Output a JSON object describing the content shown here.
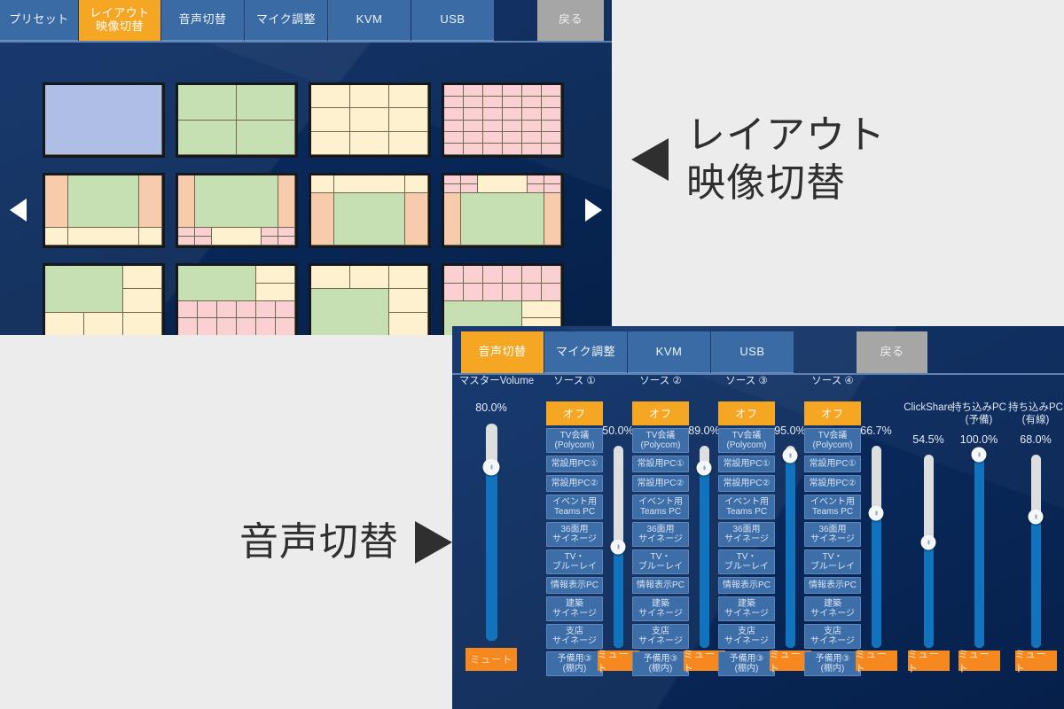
{
  "layout_panel": {
    "tabs": [
      {
        "name": "preset",
        "l1": "プリセット",
        "l2": "",
        "state": "normal"
      },
      {
        "name": "layout-video-switch",
        "l1": "レイアウト",
        "l2": "映像切替",
        "state": "active"
      },
      {
        "name": "audio-switch",
        "l1": "音声切替",
        "l2": "",
        "state": "normal"
      },
      {
        "name": "mic-adjust",
        "l1": "マイク調整",
        "l2": "",
        "state": "normal"
      },
      {
        "name": "kvm",
        "l1": "KVM",
        "l2": "",
        "state": "normal"
      },
      {
        "name": "usb",
        "l1": "USB",
        "l2": "",
        "state": "normal"
      },
      {
        "name": "back",
        "l1": "戻る",
        "l2": "",
        "state": "back"
      }
    ],
    "prev_arrow": "◀",
    "next_arrow": "▶",
    "tiles": [
      {
        "id": "tile-1",
        "selected": true,
        "cols": "1fr",
        "rows": "1fr",
        "cells": [
          {
            "c": "c-blue",
            "cs": 1,
            "rs": 1
          }
        ]
      },
      {
        "id": "tile-2",
        "selected": false,
        "cols": "1fr 1fr",
        "rows": "1fr 1fr",
        "cells": [
          {
            "c": "c-green",
            "cs": 1,
            "rs": 1
          },
          {
            "c": "c-green",
            "cs": 1,
            "rs": 1
          },
          {
            "c": "c-green",
            "cs": 1,
            "rs": 1
          },
          {
            "c": "c-green",
            "cs": 1,
            "rs": 1
          }
        ]
      },
      {
        "id": "tile-3",
        "selected": false,
        "cols": "1fr 1fr 1fr",
        "rows": "1fr 1fr 1fr",
        "cells": [
          {
            "c": "c-cream",
            "cs": 1,
            "rs": 1
          },
          {
            "c": "c-cream",
            "cs": 1,
            "rs": 1
          },
          {
            "c": "c-cream",
            "cs": 1,
            "rs": 1
          },
          {
            "c": "c-cream",
            "cs": 1,
            "rs": 1
          },
          {
            "c": "c-cream",
            "cs": 1,
            "rs": 1
          },
          {
            "c": "c-cream",
            "cs": 1,
            "rs": 1
          },
          {
            "c": "c-cream",
            "cs": 1,
            "rs": 1
          },
          {
            "c": "c-cream",
            "cs": 1,
            "rs": 1
          },
          {
            "c": "c-cream",
            "cs": 1,
            "rs": 1
          }
        ]
      },
      {
        "id": "tile-4",
        "selected": false,
        "cols": "repeat(6,1fr)",
        "rows": "repeat(6,1fr)",
        "cells": [
          {
            "c": "c-pink",
            "cs": 1,
            "rs": 1
          },
          {
            "c": "c-pink",
            "cs": 1,
            "rs": 1
          },
          {
            "c": "c-pink",
            "cs": 1,
            "rs": 1
          },
          {
            "c": "c-pink",
            "cs": 1,
            "rs": 1
          },
          {
            "c": "c-pink",
            "cs": 1,
            "rs": 1
          },
          {
            "c": "c-pink",
            "cs": 1,
            "rs": 1
          },
          {
            "c": "c-pink",
            "cs": 1,
            "rs": 1
          },
          {
            "c": "c-pink",
            "cs": 1,
            "rs": 1
          },
          {
            "c": "c-pink",
            "cs": 1,
            "rs": 1
          },
          {
            "c": "c-pink",
            "cs": 1,
            "rs": 1
          },
          {
            "c": "c-pink",
            "cs": 1,
            "rs": 1
          },
          {
            "c": "c-pink",
            "cs": 1,
            "rs": 1
          },
          {
            "c": "c-pink",
            "cs": 1,
            "rs": 1
          },
          {
            "c": "c-pink",
            "cs": 1,
            "rs": 1
          },
          {
            "c": "c-pink",
            "cs": 1,
            "rs": 1
          },
          {
            "c": "c-pink",
            "cs": 1,
            "rs": 1
          },
          {
            "c": "c-pink",
            "cs": 1,
            "rs": 1
          },
          {
            "c": "c-pink",
            "cs": 1,
            "rs": 1
          },
          {
            "c": "c-pink",
            "cs": 1,
            "rs": 1
          },
          {
            "c": "c-pink",
            "cs": 1,
            "rs": 1
          },
          {
            "c": "c-pink",
            "cs": 1,
            "rs": 1
          },
          {
            "c": "c-pink",
            "cs": 1,
            "rs": 1
          },
          {
            "c": "c-pink",
            "cs": 1,
            "rs": 1
          },
          {
            "c": "c-pink",
            "cs": 1,
            "rs": 1
          },
          {
            "c": "c-pink",
            "cs": 1,
            "rs": 1
          },
          {
            "c": "c-pink",
            "cs": 1,
            "rs": 1
          },
          {
            "c": "c-pink",
            "cs": 1,
            "rs": 1
          },
          {
            "c": "c-pink",
            "cs": 1,
            "rs": 1
          },
          {
            "c": "c-pink",
            "cs": 1,
            "rs": 1
          },
          {
            "c": "c-pink",
            "cs": 1,
            "rs": 1
          },
          {
            "c": "c-pink",
            "cs": 1,
            "rs": 1
          },
          {
            "c": "c-pink",
            "cs": 1,
            "rs": 1
          },
          {
            "c": "c-pink",
            "cs": 1,
            "rs": 1
          },
          {
            "c": "c-pink",
            "cs": 1,
            "rs": 1
          },
          {
            "c": "c-pink",
            "cs": 1,
            "rs": 1
          },
          {
            "c": "c-pink",
            "cs": 1,
            "rs": 1
          }
        ]
      },
      {
        "id": "tile-5",
        "selected": false,
        "cols": "1fr 3fr 1fr",
        "rows": "3fr 1fr",
        "cells": [
          {
            "c": "c-peach",
            "cs": 1,
            "rs": 1
          },
          {
            "c": "c-green",
            "cs": 1,
            "rs": 1
          },
          {
            "c": "c-peach",
            "cs": 1,
            "rs": 1
          },
          {
            "c": "c-cream",
            "cs": 1,
            "rs": 1
          },
          {
            "c": "c-cream",
            "cs": 1,
            "rs": 1
          },
          {
            "c": "c-cream",
            "cs": 1,
            "rs": 1
          }
        ]
      },
      {
        "id": "tile-6",
        "selected": false,
        "cols": "1fr 1fr 1fr 2fr 1fr 1fr",
        "rows": "3fr 3fr 1fr 1fr",
        "cells": [
          {
            "c": "c-peach",
            "cs": 1,
            "rs": 2
          },
          {
            "c": "c-green",
            "cs": 4,
            "rs": 2
          },
          {
            "c": "c-peach",
            "cs": 1,
            "rs": 2
          },
          {
            "c": "c-pink",
            "cs": 1,
            "rs": 1
          },
          {
            "c": "c-pink",
            "cs": 1,
            "rs": 1
          },
          {
            "c": "c-cream",
            "cs": 2,
            "rs": 2
          },
          {
            "c": "c-pink",
            "cs": 1,
            "rs": 1
          },
          {
            "c": "c-pink",
            "cs": 1,
            "rs": 1
          },
          {
            "c": "c-pink",
            "cs": 1,
            "rs": 1
          },
          {
            "c": "c-pink",
            "cs": 1,
            "rs": 1
          },
          {
            "c": "c-pink",
            "cs": 1,
            "rs": 1
          },
          {
            "c": "c-pink",
            "cs": 1,
            "rs": 1
          }
        ]
      },
      {
        "id": "tile-7",
        "selected": false,
        "cols": "1fr 3fr 1fr",
        "rows": "1fr 3fr",
        "cells": [
          {
            "c": "c-cream",
            "cs": 1,
            "rs": 1
          },
          {
            "c": "c-cream",
            "cs": 1,
            "rs": 1
          },
          {
            "c": "c-cream",
            "cs": 1,
            "rs": 1
          },
          {
            "c": "c-peach",
            "cs": 1,
            "rs": 1
          },
          {
            "c": "c-green",
            "cs": 1,
            "rs": 1
          },
          {
            "c": "c-peach",
            "cs": 1,
            "rs": 1
          }
        ]
      },
      {
        "id": "tile-8",
        "selected": false,
        "cols": "1fr 1fr 1fr 2fr 1fr 1fr",
        "rows": "1fr 1fr 3fr 3fr",
        "cells": [
          {
            "c": "c-pink",
            "cs": 1,
            "rs": 1
          },
          {
            "c": "c-pink",
            "cs": 1,
            "rs": 1
          },
          {
            "c": "c-cream",
            "cs": 2,
            "rs": 2
          },
          {
            "c": "c-pink",
            "cs": 1,
            "rs": 1
          },
          {
            "c": "c-pink",
            "cs": 1,
            "rs": 1
          },
          {
            "c": "c-pink",
            "cs": 1,
            "rs": 1
          },
          {
            "c": "c-pink",
            "cs": 1,
            "rs": 1
          },
          {
            "c": "c-pink",
            "cs": 1,
            "rs": 1
          },
          {
            "c": "c-pink",
            "cs": 1,
            "rs": 1
          },
          {
            "c": "c-peach",
            "cs": 1,
            "rs": 2
          },
          {
            "c": "c-green",
            "cs": 4,
            "rs": 2
          },
          {
            "c": "c-peach",
            "cs": 1,
            "rs": 2
          }
        ]
      },
      {
        "id": "tile-9",
        "selected": false,
        "cols": "1fr 1fr 1fr",
        "rows": "1fr 1fr 1fr",
        "cells": [
          {
            "c": "c-green",
            "cs": 2,
            "rs": 2
          },
          {
            "c": "c-cream",
            "cs": 1,
            "rs": 1
          },
          {
            "c": "c-cream",
            "cs": 1,
            "rs": 1
          },
          {
            "c": "c-cream",
            "cs": 1,
            "rs": 1
          },
          {
            "c": "c-cream",
            "cs": 1,
            "rs": 1
          },
          {
            "c": "c-cream",
            "cs": 1,
            "rs": 1
          }
        ]
      },
      {
        "id": "tile-10",
        "selected": false,
        "cols": "1fr 1fr 1fr 1fr 1fr 1fr",
        "rows": "1fr 1fr 1fr 1fr",
        "cells": [
          {
            "c": "c-green",
            "cs": 4,
            "rs": 2
          },
          {
            "c": "c-cream",
            "cs": 2,
            "rs": 1
          },
          {
            "c": "c-cream",
            "cs": 2,
            "rs": 1
          },
          {
            "c": "c-pink",
            "cs": 1,
            "rs": 1
          },
          {
            "c": "c-pink",
            "cs": 1,
            "rs": 1
          },
          {
            "c": "c-pink",
            "cs": 1,
            "rs": 1
          },
          {
            "c": "c-pink",
            "cs": 1,
            "rs": 1
          },
          {
            "c": "c-pink",
            "cs": 1,
            "rs": 1
          },
          {
            "c": "c-pink",
            "cs": 1,
            "rs": 1
          },
          {
            "c": "c-pink",
            "cs": 1,
            "rs": 1
          },
          {
            "c": "c-pink",
            "cs": 1,
            "rs": 1
          },
          {
            "c": "c-pink",
            "cs": 1,
            "rs": 1
          },
          {
            "c": "c-pink",
            "cs": 1,
            "rs": 1
          },
          {
            "c": "c-pink",
            "cs": 1,
            "rs": 1
          },
          {
            "c": "c-pink",
            "cs": 1,
            "rs": 1
          }
        ]
      },
      {
        "id": "tile-11",
        "selected": false,
        "cols": "1fr 1fr 1fr",
        "rows": "1fr 1fr 1fr",
        "cells": [
          {
            "c": "c-cream",
            "cs": 1,
            "rs": 1
          },
          {
            "c": "c-cream",
            "cs": 1,
            "rs": 1
          },
          {
            "c": "c-cream",
            "cs": 1,
            "rs": 1
          },
          {
            "c": "c-green",
            "cs": 2,
            "rs": 2
          },
          {
            "c": "c-cream",
            "cs": 1,
            "rs": 1
          },
          {
            "c": "c-cream",
            "cs": 1,
            "rs": 1
          }
        ]
      },
      {
        "id": "tile-12",
        "selected": false,
        "cols": "1fr 1fr 1fr 1fr 1fr 1fr",
        "rows": "1fr 1fr 1fr 1fr",
        "cells": [
          {
            "c": "c-pink",
            "cs": 1,
            "rs": 1
          },
          {
            "c": "c-pink",
            "cs": 1,
            "rs": 1
          },
          {
            "c": "c-pink",
            "cs": 1,
            "rs": 1
          },
          {
            "c": "c-pink",
            "cs": 1,
            "rs": 1
          },
          {
            "c": "c-pink",
            "cs": 1,
            "rs": 1
          },
          {
            "c": "c-pink",
            "cs": 1,
            "rs": 1
          },
          {
            "c": "c-pink",
            "cs": 1,
            "rs": 1
          },
          {
            "c": "c-pink",
            "cs": 1,
            "rs": 1
          },
          {
            "c": "c-pink",
            "cs": 1,
            "rs": 1
          },
          {
            "c": "c-pink",
            "cs": 1,
            "rs": 1
          },
          {
            "c": "c-pink",
            "cs": 1,
            "rs": 1
          },
          {
            "c": "c-pink",
            "cs": 1,
            "rs": 1
          },
          {
            "c": "c-green",
            "cs": 4,
            "rs": 2
          },
          {
            "c": "c-cream",
            "cs": 2,
            "rs": 1
          },
          {
            "c": "c-cream",
            "cs": 2,
            "rs": 1
          }
        ]
      }
    ]
  },
  "annotations": {
    "layout_label_line1": "レイアウト",
    "layout_label_line2": "映像切替",
    "layout_arrow": "◀",
    "audio_label": "音声切替",
    "audio_arrow": "▶"
  },
  "audio_panel": {
    "tabs": [
      {
        "name": "audio-switch",
        "l1": "音声切替",
        "state": "active"
      },
      {
        "name": "mic-adjust",
        "l1": "マイク調整",
        "state": "normal"
      },
      {
        "name": "kvm",
        "l1": "KVM",
        "state": "normal"
      },
      {
        "name": "usb",
        "l1": "USB",
        "state": "normal"
      },
      {
        "name": "back",
        "l1": "戻る",
        "state": "back"
      }
    ],
    "master": {
      "label": "マスターVolume",
      "percent": "80.0%",
      "value": 80.0,
      "mute_label": "ミュート"
    },
    "source_options": [
      {
        "label": "オフ",
        "selected": true
      },
      {
        "label": "TV会議\n(Polycom)",
        "selected": false
      },
      {
        "label": "常設用PC①",
        "selected": false
      },
      {
        "label": "常設用PC②",
        "selected": false
      },
      {
        "label": "イベント用\nTeams PC",
        "selected": false
      },
      {
        "label": "36面用\nサイネージ",
        "selected": false
      },
      {
        "label": "TV・\nブルーレイ",
        "selected": false
      },
      {
        "label": "情報表示PC",
        "selected": false
      },
      {
        "label": "建築\nサイネージ",
        "selected": false
      },
      {
        "label": "支店\nサイネージ",
        "selected": false
      },
      {
        "label": "予備用③\n(棚内)",
        "selected": false
      }
    ],
    "sources": [
      {
        "name": "source-1",
        "header": "ソース ①",
        "percent": "50.0%",
        "value": 50.0,
        "mute_label": "ミュート"
      },
      {
        "name": "source-2",
        "header": "ソース ②",
        "percent": "89.0%",
        "value": 89.0,
        "mute_label": "ミュート"
      },
      {
        "name": "source-3",
        "header": "ソース ③",
        "percent": "95.0%",
        "value": 95.0,
        "mute_label": "ミュート"
      },
      {
        "name": "source-4",
        "header": "ソース ④",
        "percent": "66.7%",
        "value": 66.7,
        "mute_label": "ミュート"
      }
    ],
    "extra_sliders": [
      {
        "name": "clickshare",
        "header": "ClickShare",
        "percent": "54.5%",
        "value": 54.5,
        "mute_label": "ミュート"
      },
      {
        "name": "byod-pc-spare",
        "header": "持ち込みPC\n(予備)",
        "percent": "100.0%",
        "value": 100.0,
        "mute_label": "ミュート"
      },
      {
        "name": "byod-pc-wired",
        "header": "持ち込みPC\n(有線)",
        "percent": "68.0%",
        "value": 68.0,
        "mute_label": "ミュート"
      }
    ]
  },
  "colors": {
    "panel_bg": "#0a2a5e",
    "tab_normal": "#3b6ba5",
    "tab_active": "#f5a623",
    "tab_back": "#a6a6a6",
    "mute_orange": "#f5881f",
    "slider_fill": "#1173bd",
    "slider_track": "#dedede",
    "selected_tile_border": "#e02a1a",
    "page_bg": "#ececec"
  }
}
